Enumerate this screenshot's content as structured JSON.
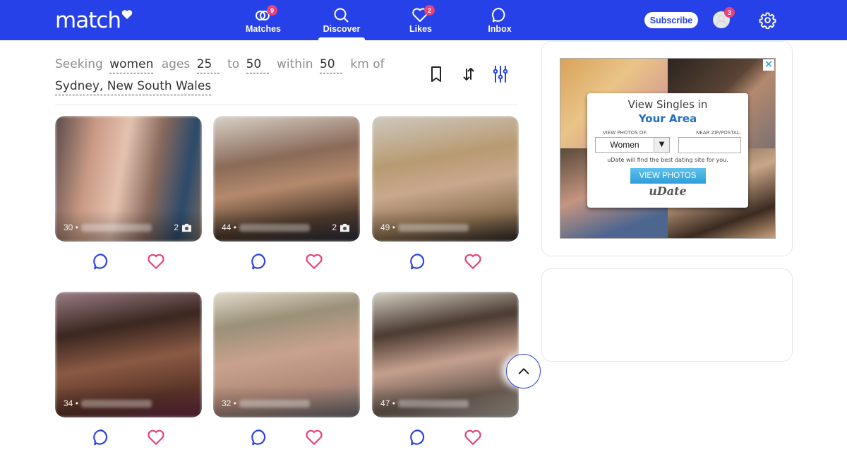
{
  "brand": {
    "logo_text": "match",
    "primary_color": "#2741e8",
    "badge_color": "#e8417a",
    "like_color": "#e8417a"
  },
  "nav": {
    "items": [
      {
        "label": "Matches",
        "icon": "rings-icon",
        "badge": "9"
      },
      {
        "label": "Discover",
        "icon": "search-icon",
        "badge": null,
        "active": true
      },
      {
        "label": "Likes",
        "icon": "heart-icon",
        "badge": "2"
      },
      {
        "label": "Inbox",
        "icon": "chat-bubble-icon",
        "badge": null
      }
    ],
    "subscribe_label": "Subscribe",
    "avatar_badge": "3"
  },
  "criteria": {
    "seeking_label": "Seeking",
    "gender": "women",
    "ages_label": "ages",
    "age_min": "25",
    "to_label": "to",
    "age_max": "50",
    "within_label": "within",
    "distance": "50",
    "unit_label": "km of",
    "location": "Sydney, New South Wales"
  },
  "toolbar": {
    "icons": [
      "bookmark-icon",
      "sort-icon",
      "filters-icon"
    ]
  },
  "profiles": [
    {
      "age": "30",
      "photo_count": "2"
    },
    {
      "age": "44",
      "photo_count": "2"
    },
    {
      "age": "49",
      "photo_count": null
    },
    {
      "age": "34",
      "photo_count": null
    },
    {
      "age": "32",
      "photo_count": null
    },
    {
      "age": "47",
      "photo_count": null
    }
  ],
  "ad": {
    "title_line1": "View Singles in",
    "title_line2": "Your Area",
    "view_photos_of_label": "VIEW PHOTOS OF:",
    "near_zip_label": "NEAR ZIP/POSTAL:",
    "select_value": "Women",
    "zip_value": "",
    "note": "uDate will find the best dating site for you.",
    "button_label": "VIEW PHOTOS",
    "brand": "uDate",
    "close_glyph": "✕"
  }
}
